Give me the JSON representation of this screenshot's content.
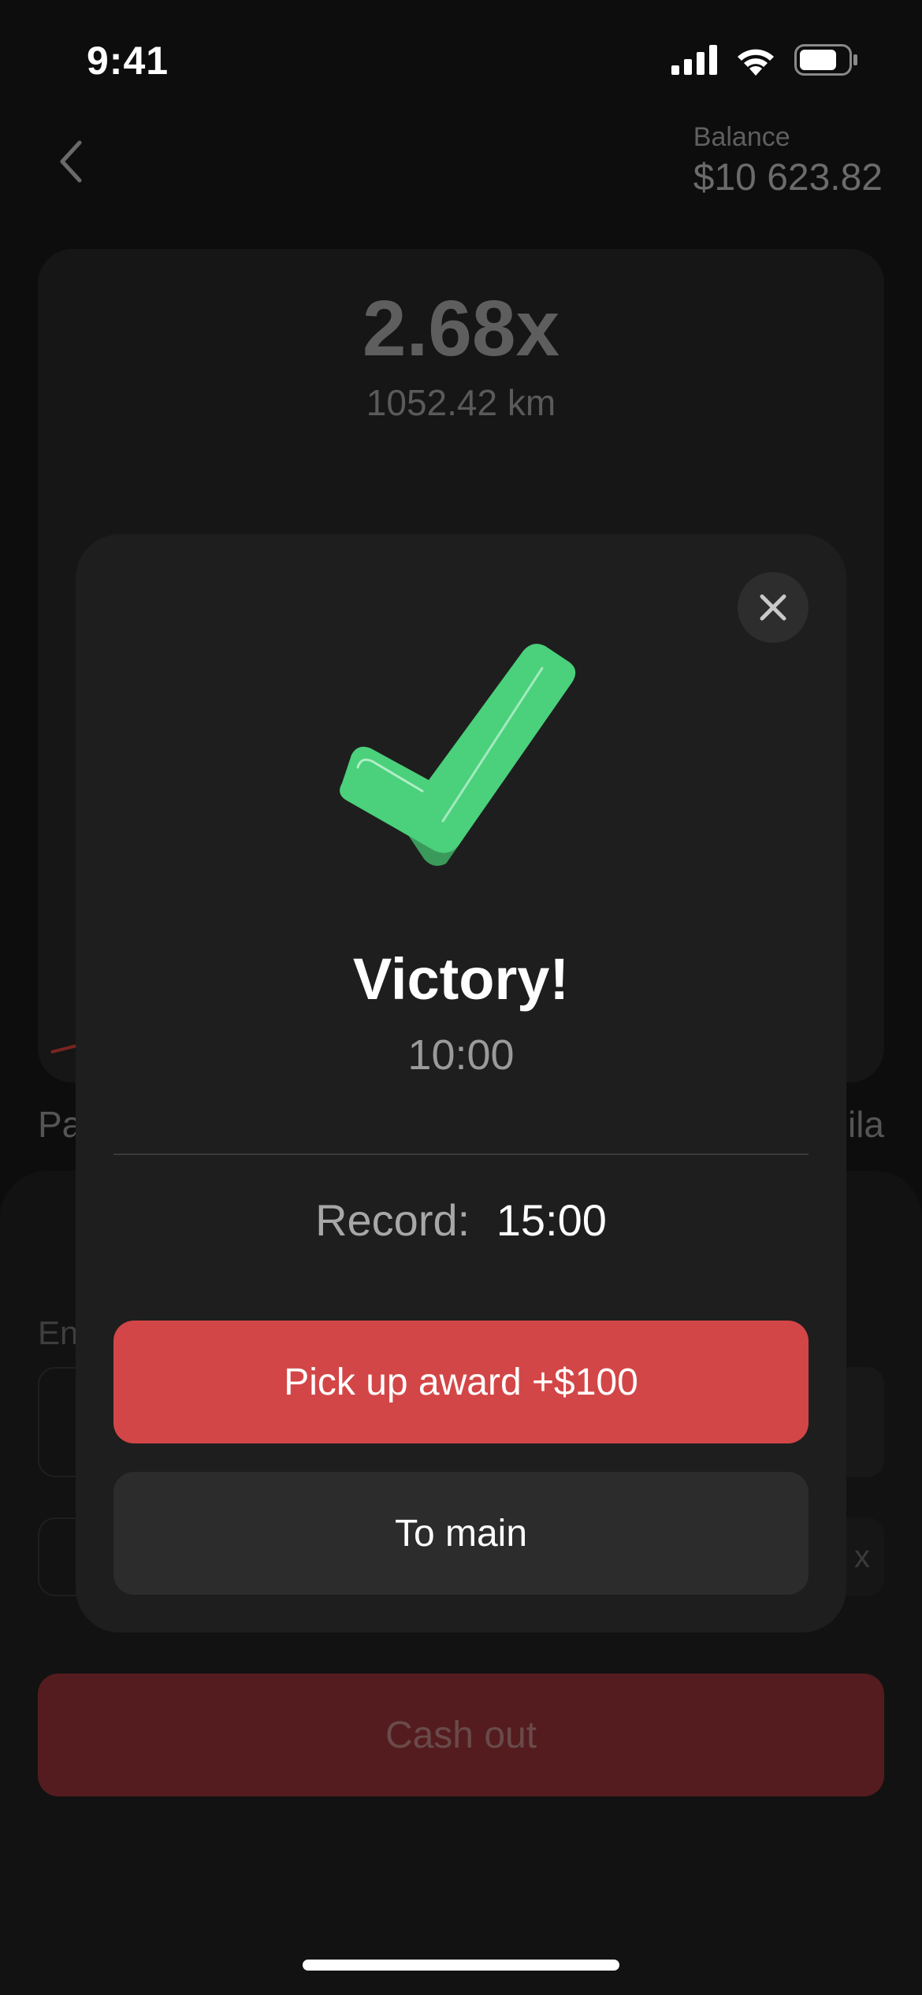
{
  "status_bar": {
    "time": "9:41"
  },
  "header": {
    "balance_label": "Balance",
    "balance_value": "$10 623.82"
  },
  "game": {
    "multiplier": "2.68x",
    "distance": "1052.42 km",
    "partial_left_text": "Pa",
    "partial_right_text": "ila"
  },
  "panel": {
    "partial_input_label": "En",
    "partial_chip_right": "x",
    "cashout_label": "Cash out"
  },
  "modal": {
    "title": "Victory!",
    "time": "10:00",
    "record_label": "Record:",
    "record_value": "15:00",
    "award_button_label": "Pick up award +$100",
    "main_button_label": "To main"
  },
  "colors": {
    "accent_red": "#d34647",
    "check_green": "#4bd07c"
  }
}
